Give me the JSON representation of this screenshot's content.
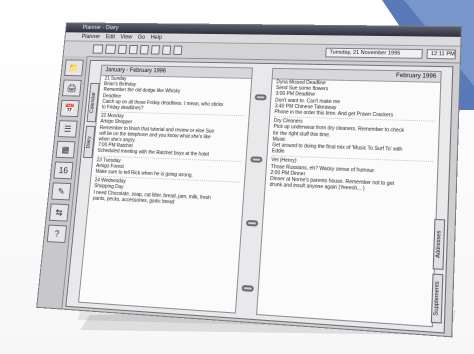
{
  "window": {
    "title": "Planner - Diary",
    "menu": [
      "Planner",
      "Edit",
      "View",
      "Go",
      "Help"
    ]
  },
  "toolbar": {
    "day_label": "Tuesday, 21 November 1995",
    "time_label": "12:11 PM"
  },
  "left_page": {
    "header": "January - February 1996",
    "lines": [
      "21 Sunday",
      "Brian's Birthday",
      "Remember the old dodge like Whisky",
      "Deadline",
      "Catch up on all those Friday deadlines. I mean, who sticks",
      "to Friday deadlines?",
      "",
      "22 Monday",
      "Amigo Shopper",
      "Remember to finish that tutorial and review or else Sue",
      "will be on the telephone and you know what she's like",
      "when she's angry.",
      "7:00 PM  Ratchet",
      "Scheduled meeting with the Ratchet boys at the hotel",
      "",
      "23 Tuesday",
      "Amigo Forest",
      "Make sure to tell Rick when he is going wrong.",
      "",
      "24 Wednesday",
      "Shopping Day",
      "I need Chocolate, soap, cat litter, bread, jam, milk, fresh",
      "pants, pecks, accessories, garlic bread"
    ]
  },
  "right_page": {
    "header": "February 1996",
    "lines": [
      "Dyna Missed Deadline",
      "Send Sue some flowers",
      "3:00 PM  Deadline",
      "Don't want to. Can't make me",
      "3:40 PM  Chinese Takeaway",
      "Phone in the order this time. And get Prawn Crackers",
      "",
      "Dry Cleaners",
      "Pick up underwear from dry cleaners. Remember to check",
      "for the right stuff this time.",
      "Music",
      "Get around to doing the final mix of 'Music To Surf To' with",
      "Eddie",
      "",
      "Vet (Henry)",
      "Those Russians, eh? Wacky sense of humour.",
      "2:00 PM  Dinner",
      "Dinner at Norne's parents house. Remember not to get",
      "drunk and insult anyone again (Yeeesh... )"
    ]
  },
  "tabs": {
    "left": [
      "Calendar",
      "Diary"
    ],
    "right": [
      "Addresses",
      "Supplements"
    ]
  }
}
